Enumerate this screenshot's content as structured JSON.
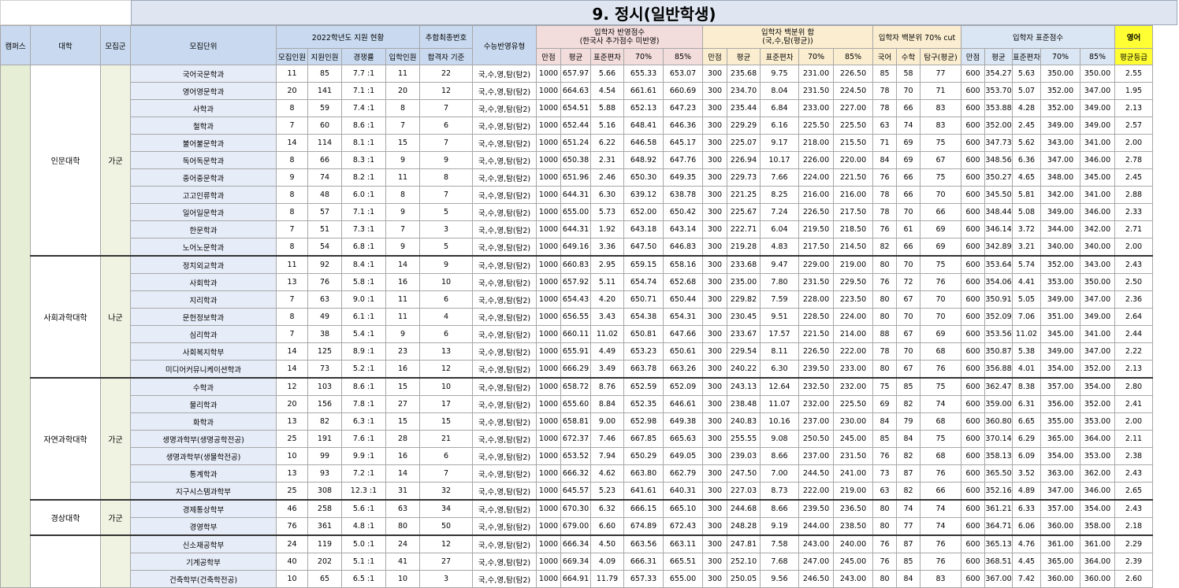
{
  "title": "9. 정시(일반학생)",
  "headers": {
    "campus": "캠퍼스",
    "college": "대학",
    "group": "모집군",
    "unit": "모집단위",
    "apply_status": "2022학년도 지원 현황",
    "apply_cols": [
      "모집인원",
      "지원인원",
      "경쟁률",
      "입학인원"
    ],
    "final_no": "추합최종번호",
    "final_no_sub": "합격자 기준",
    "suneung_type": "수능반영유형",
    "reflect_score": "입학자 반영점수\n(한국사 추가점수 미반영)",
    "reflect_score_line1": "입학자 반영점수",
    "reflect_score_line2": "(한국사 추가점수 미반영)",
    "reflect_cols": [
      "만점",
      "평균",
      "표준편차",
      "70%",
      "85%"
    ],
    "pct_sum_line1": "입학자 백분위 합",
    "pct_sum_line2": "(국,수,탐(평균))",
    "pct_sum_cols": [
      "만점",
      "평균",
      "표준편차",
      "70%",
      "85%"
    ],
    "pct70": "입학자 백분위 70% cut",
    "pct70_cols": [
      "국어",
      "수학",
      "탐구(평균)"
    ],
    "std_score": "입학자 표준점수",
    "std_cols": [
      "만점",
      "평균",
      "표준편차",
      "70%",
      "85%"
    ],
    "english": "영어",
    "english_sub": "평균등급"
  },
  "groups": [
    {
      "college": "인문대학",
      "group": "가군",
      "rows": [
        [
          "국어국문학과",
          "11",
          "85",
          "7.7 :1",
          "11",
          "22",
          "국,수,영,탐(탐2)",
          "1000",
          "657.97",
          "5.66",
          "655.33",
          "653.07",
          "300",
          "235.68",
          "9.75",
          "231.00",
          "226.50",
          "85",
          "58",
          "77",
          "600",
          "354.27",
          "5.63",
          "350.00",
          "350.00",
          "2.55"
        ],
        [
          "영어영문학과",
          "20",
          "141",
          "7.1 :1",
          "20",
          "12",
          "국,수,영,탐(탐2)",
          "1000",
          "664.63",
          "4.54",
          "661.61",
          "660.69",
          "300",
          "234.70",
          "8.04",
          "231.50",
          "224.50",
          "78",
          "70",
          "71",
          "600",
          "353.70",
          "5.07",
          "352.00",
          "347.00",
          "1.95"
        ],
        [
          "사학과",
          "8",
          "59",
          "7.4 :1",
          "8",
          "7",
          "국,수,영,탐(탐2)",
          "1000",
          "654.51",
          "5.88",
          "652.13",
          "647.23",
          "300",
          "235.44",
          "6.84",
          "233.00",
          "227.00",
          "78",
          "66",
          "83",
          "600",
          "353.88",
          "4.28",
          "352.00",
          "349.00",
          "2.13"
        ],
        [
          "철학과",
          "7",
          "60",
          "8.6 :1",
          "7",
          "6",
          "국,수,영,탐(탐2)",
          "1000",
          "652.44",
          "5.16",
          "648.41",
          "646.36",
          "300",
          "229.29",
          "6.16",
          "225.50",
          "225.50",
          "63",
          "74",
          "83",
          "600",
          "352.00",
          "2.45",
          "349.00",
          "349.00",
          "2.57"
        ],
        [
          "불어불문학과",
          "14",
          "114",
          "8.1 :1",
          "15",
          "7",
          "국,수,영,탐(탐2)",
          "1000",
          "651.24",
          "6.22",
          "646.58",
          "645.17",
          "300",
          "225.07",
          "9.17",
          "218.00",
          "215.50",
          "71",
          "69",
          "75",
          "600",
          "347.73",
          "5.62",
          "343.00",
          "341.00",
          "2.00"
        ],
        [
          "독어독문학과",
          "8",
          "66",
          "8.3 :1",
          "9",
          "9",
          "국,수,영,탐(탐2)",
          "1000",
          "650.38",
          "2.31",
          "648.92",
          "647.76",
          "300",
          "226.94",
          "10.17",
          "226.00",
          "220.00",
          "84",
          "69",
          "67",
          "600",
          "348.56",
          "6.36",
          "347.00",
          "346.00",
          "2.78"
        ],
        [
          "중어중문학과",
          "9",
          "74",
          "8.2 :1",
          "11",
          "8",
          "국,수,영,탐(탐2)",
          "1000",
          "651.96",
          "2.46",
          "650.30",
          "649.35",
          "300",
          "229.73",
          "7.66",
          "224.00",
          "221.50",
          "76",
          "66",
          "75",
          "600",
          "350.27",
          "4.65",
          "348.00",
          "345.00",
          "2.45"
        ],
        [
          "고고인류학과",
          "8",
          "48",
          "6.0 :1",
          "8",
          "7",
          "국,수,영,탐(탐2)",
          "1000",
          "644.31",
          "6.30",
          "639.12",
          "638.78",
          "300",
          "221.25",
          "8.25",
          "216.00",
          "216.00",
          "78",
          "66",
          "70",
          "600",
          "345.50",
          "5.81",
          "342.00",
          "341.00",
          "2.88"
        ],
        [
          "일어일문학과",
          "8",
          "57",
          "7.1 :1",
          "9",
          "5",
          "국,수,영,탐(탐2)",
          "1000",
          "655.00",
          "5.73",
          "652.00",
          "650.42",
          "300",
          "225.67",
          "7.24",
          "226.50",
          "217.50",
          "78",
          "70",
          "66",
          "600",
          "348.44",
          "5.08",
          "349.00",
          "346.00",
          "2.33"
        ],
        [
          "한문학과",
          "7",
          "51",
          "7.3 :1",
          "7",
          "3",
          "국,수,영,탐(탐2)",
          "1000",
          "644.31",
          "1.92",
          "643.18",
          "643.14",
          "300",
          "222.71",
          "6.04",
          "219.50",
          "218.50",
          "76",
          "61",
          "69",
          "600",
          "346.14",
          "3.72",
          "344.00",
          "342.00",
          "2.71"
        ],
        [
          "노어노문학과",
          "8",
          "54",
          "6.8 :1",
          "9",
          "5",
          "국,수,영,탐(탐2)",
          "1000",
          "649.16",
          "3.36",
          "647.50",
          "646.83",
          "300",
          "219.28",
          "4.83",
          "217.50",
          "214.50",
          "82",
          "66",
          "69",
          "600",
          "342.89",
          "3.21",
          "340.00",
          "340.00",
          "2.00"
        ]
      ]
    },
    {
      "college": "사회과학대학",
      "group": "나군",
      "rows": [
        [
          "정치외교학과",
          "11",
          "92",
          "8.4 :1",
          "14",
          "9",
          "국,수,영,탐(탐2)",
          "1000",
          "660.83",
          "2.95",
          "659.15",
          "658.16",
          "300",
          "233.68",
          "9.47",
          "229.00",
          "219.00",
          "80",
          "70",
          "75",
          "600",
          "353.64",
          "5.74",
          "352.00",
          "343.00",
          "2.43"
        ],
        [
          "사회학과",
          "13",
          "76",
          "5.8 :1",
          "16",
          "10",
          "국,수,영,탐(탐2)",
          "1000",
          "657.92",
          "5.11",
          "654.74",
          "652.68",
          "300",
          "235.00",
          "7.80",
          "231.50",
          "229.50",
          "76",
          "72",
          "76",
          "600",
          "354.06",
          "4.41",
          "353.00",
          "350.00",
          "2.50"
        ],
        [
          "지리학과",
          "7",
          "63",
          "9.0 :1",
          "11",
          "6",
          "국,수,영,탐(탐2)",
          "1000",
          "654.43",
          "4.20",
          "650.71",
          "650.44",
          "300",
          "229.82",
          "7.59",
          "228.00",
          "223.50",
          "80",
          "67",
          "70",
          "600",
          "350.91",
          "5.05",
          "349.00",
          "347.00",
          "2.36"
        ],
        [
          "문헌정보학과",
          "8",
          "49",
          "6.1 :1",
          "11",
          "4",
          "국,수,영,탐(탐2)",
          "1000",
          "656.55",
          "3.43",
          "654.38",
          "654.31",
          "300",
          "230.45",
          "9.51",
          "228.50",
          "224.00",
          "80",
          "70",
          "70",
          "600",
          "352.09",
          "7.06",
          "351.00",
          "349.00",
          "2.64"
        ],
        [
          "심리학과",
          "7",
          "38",
          "5.4 :1",
          "9",
          "6",
          "국,수,영,탐(탐2)",
          "1000",
          "660.11",
          "11.02",
          "650.81",
          "647.66",
          "300",
          "233.67",
          "17.57",
          "221.50",
          "214.00",
          "88",
          "67",
          "69",
          "600",
          "353.56",
          "11.02",
          "345.00",
          "341.00",
          "2.44"
        ],
        [
          "사회복지학부",
          "14",
          "125",
          "8.9 :1",
          "23",
          "13",
          "국,수,영,탐(탐2)",
          "1000",
          "655.91",
          "4.49",
          "653.23",
          "650.61",
          "300",
          "229.54",
          "8.11",
          "226.50",
          "222.00",
          "78",
          "70",
          "68",
          "600",
          "350.87",
          "5.38",
          "349.00",
          "347.00",
          "2.22"
        ],
        [
          "미디어커뮤니케이션학과",
          "14",
          "73",
          "5.2 :1",
          "16",
          "12",
          "국,수,영,탐(탐2)",
          "1000",
          "666.29",
          "3.49",
          "663.78",
          "663.26",
          "300",
          "240.22",
          "6.30",
          "239.50",
          "233.00",
          "80",
          "67",
          "76",
          "600",
          "356.88",
          "4.01",
          "354.00",
          "352.00",
          "2.13"
        ]
      ]
    },
    {
      "college": "자연과학대학",
      "group": "가군",
      "rows": [
        [
          "수학과",
          "12",
          "103",
          "8.6 :1",
          "15",
          "10",
          "국,수,영,탐(탐2)",
          "1000",
          "658.72",
          "8.76",
          "652.59",
          "652.09",
          "300",
          "243.13",
          "12.64",
          "232.50",
          "232.00",
          "75",
          "85",
          "75",
          "600",
          "362.47",
          "8.38",
          "357.00",
          "354.00",
          "2.80"
        ],
        [
          "물리학과",
          "20",
          "156",
          "7.8 :1",
          "27",
          "17",
          "국,수,영,탐(탐2)",
          "1000",
          "655.60",
          "8.84",
          "652.35",
          "646.61",
          "300",
          "238.48",
          "11.07",
          "232.00",
          "225.50",
          "69",
          "82",
          "74",
          "600",
          "359.00",
          "6.31",
          "356.00",
          "352.00",
          "2.41"
        ],
        [
          "화학과",
          "13",
          "82",
          "6.3 :1",
          "15",
          "15",
          "국,수,영,탐(탐2)",
          "1000",
          "658.81",
          "9.00",
          "652.98",
          "649.38",
          "300",
          "240.83",
          "10.16",
          "237.00",
          "230.00",
          "84",
          "79",
          "68",
          "600",
          "360.80",
          "6.65",
          "355.00",
          "353.00",
          "2.00"
        ],
        [
          "생명과학부(생명공학전공)",
          "25",
          "191",
          "7.6 :1",
          "28",
          "21",
          "국,수,영,탐(탐2)",
          "1000",
          "672.37",
          "7.46",
          "667.85",
          "665.63",
          "300",
          "255.55",
          "9.08",
          "250.50",
          "245.00",
          "85",
          "84",
          "75",
          "600",
          "370.14",
          "6.29",
          "365.00",
          "364.00",
          "2.11"
        ],
        [
          "생명과학부(생물학전공)",
          "10",
          "99",
          "9.9 :1",
          "16",
          "6",
          "국,수,영,탐(탐2)",
          "1000",
          "653.52",
          "7.94",
          "650.29",
          "649.05",
          "300",
          "239.03",
          "8.66",
          "237.00",
          "231.50",
          "76",
          "82",
          "68",
          "600",
          "358.13",
          "6.09",
          "354.00",
          "353.00",
          "2.38"
        ],
        [
          "통계학과",
          "13",
          "93",
          "7.2 :1",
          "14",
          "7",
          "국,수,영,탐(탐2)",
          "1000",
          "666.32",
          "4.62",
          "663.80",
          "662.79",
          "300",
          "247.50",
          "7.00",
          "244.50",
          "241.00",
          "73",
          "87",
          "76",
          "600",
          "365.50",
          "3.52",
          "363.00",
          "362.00",
          "2.43"
        ],
        [
          "지구시스템과학부",
          "25",
          "308",
          "12.3 :1",
          "31",
          "32",
          "국,수,영,탐(탐2)",
          "1000",
          "645.57",
          "5.23",
          "641.61",
          "640.31",
          "300",
          "227.03",
          "8.73",
          "222.00",
          "219.00",
          "63",
          "82",
          "66",
          "600",
          "352.16",
          "4.89",
          "347.00",
          "346.00",
          "2.65"
        ]
      ]
    },
    {
      "college": "경상대학",
      "group": "가군",
      "rows": [
        [
          "경제통상학부",
          "46",
          "258",
          "5.6 :1",
          "63",
          "34",
          "국,수,영,탐(탐2)",
          "1000",
          "670.30",
          "6.32",
          "666.15",
          "665.10",
          "300",
          "244.68",
          "8.66",
          "239.50",
          "236.50",
          "80",
          "74",
          "74",
          "600",
          "361.21",
          "6.33",
          "357.00",
          "354.00",
          "2.43"
        ],
        [
          "경영학부",
          "76",
          "361",
          "4.8 :1",
          "80",
          "50",
          "국,수,영,탐(탐2)",
          "1000",
          "679.00",
          "6.60",
          "674.89",
          "672.43",
          "300",
          "248.28",
          "9.19",
          "244.00",
          "238.50",
          "80",
          "77",
          "74",
          "600",
          "364.71",
          "6.06",
          "360.00",
          "358.00",
          "2.18"
        ]
      ]
    },
    {
      "college": "",
      "group": "",
      "rows": [
        [
          "신소재공학부",
          "24",
          "119",
          "5.0 :1",
          "24",
          "12",
          "국,수,영,탐(탐2)",
          "1000",
          "666.34",
          "4.50",
          "663.56",
          "663.11",
          "300",
          "247.81",
          "7.58",
          "243.00",
          "240.00",
          "76",
          "87",
          "76",
          "600",
          "365.13",
          "4.76",
          "361.00",
          "361.00",
          "2.29"
        ],
        [
          "기계공학부",
          "40",
          "202",
          "5.1 :1",
          "41",
          "27",
          "국,수,영,탐(탐2)",
          "1000",
          "669.34",
          "4.09",
          "666.31",
          "665.51",
          "300",
          "252.10",
          "7.68",
          "247.00",
          "245.00",
          "76",
          "85",
          "76",
          "600",
          "368.51",
          "4.45",
          "365.00",
          "364.00",
          "2.39"
        ],
        [
          "건축학부(건축학전공)",
          "10",
          "65",
          "6.5 :1",
          "10",
          "3",
          "국,수,영,탐(탐2)",
          "1000",
          "664.91",
          "11.79",
          "657.33",
          "655.00",
          "300",
          "250.05",
          "9.56",
          "246.50",
          "243.00",
          "80",
          "84",
          "83",
          "600",
          "367.00",
          "7.42",
          "360.00",
          "360.00",
          "2.60"
        ]
      ]
    }
  ]
}
